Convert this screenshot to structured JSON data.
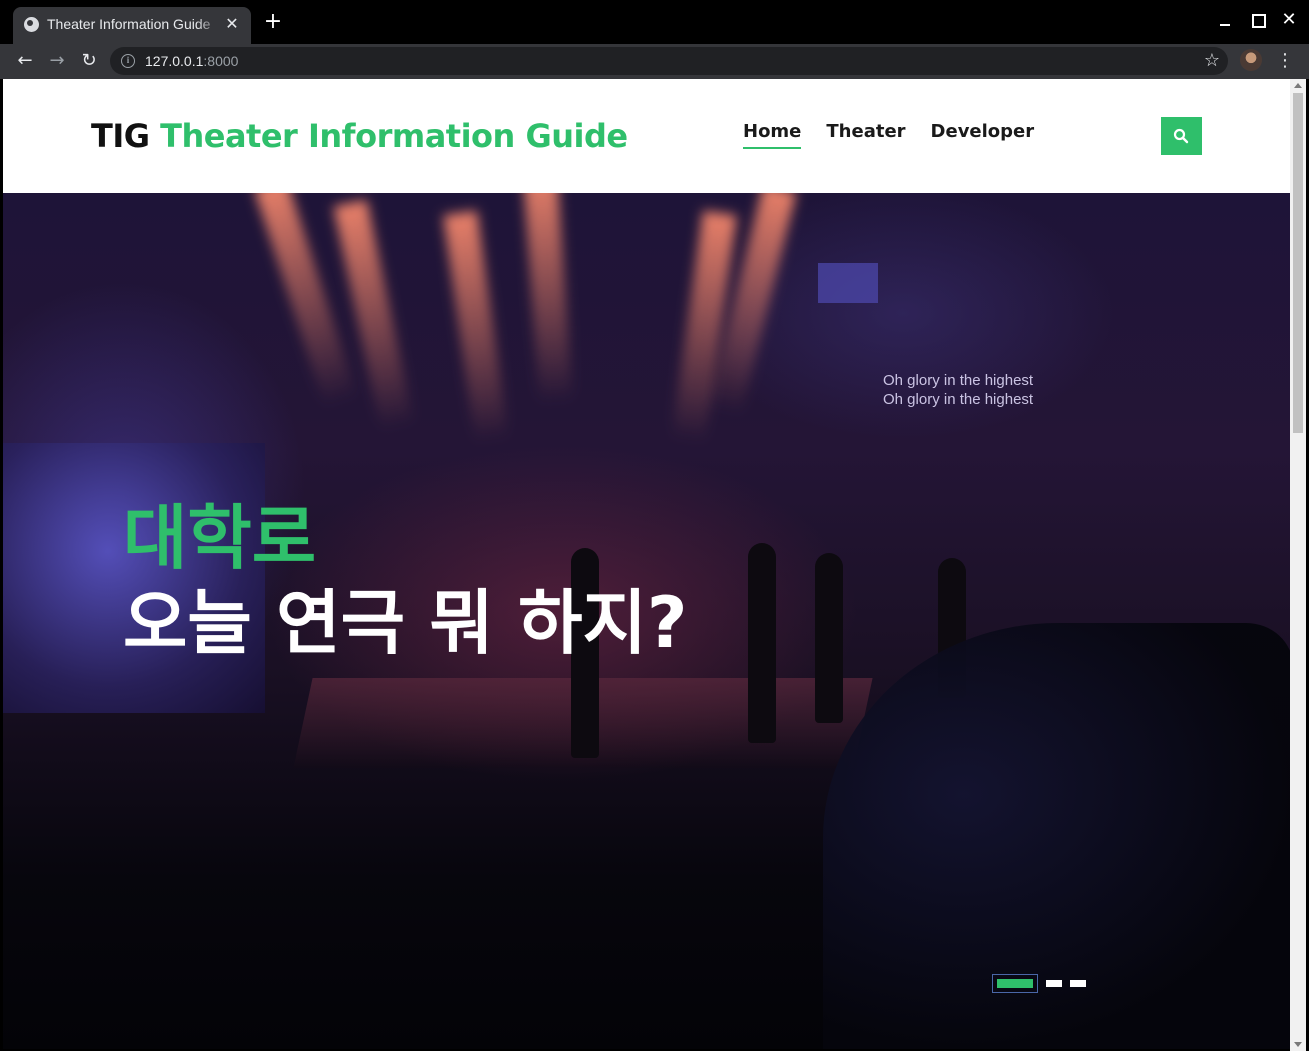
{
  "browser": {
    "tab_title": "Theater Information Guide",
    "tab_close": "✕",
    "new_tab": "+",
    "url_host": "127.0.0.1",
    "url_port": ":8000",
    "star": "☆",
    "menu": "⋮"
  },
  "header": {
    "logo_abbr": "TIG",
    "logo_full": "Theater Information Guide",
    "nav": [
      {
        "label": "Home",
        "active": true
      },
      {
        "label": "Theater",
        "active": false
      },
      {
        "label": "Developer",
        "active": false
      }
    ]
  },
  "hero": {
    "subtitle": "대학로",
    "title": "오늘 연극 뭐 하지?",
    "background_lyrics": [
      "Oh glory in the highest",
      "Oh glory in the highest"
    ],
    "slides_total": 3,
    "slide_active": 1
  },
  "colors": {
    "accent": "#2fbf6b",
    "header_bg": "#ffffff"
  }
}
